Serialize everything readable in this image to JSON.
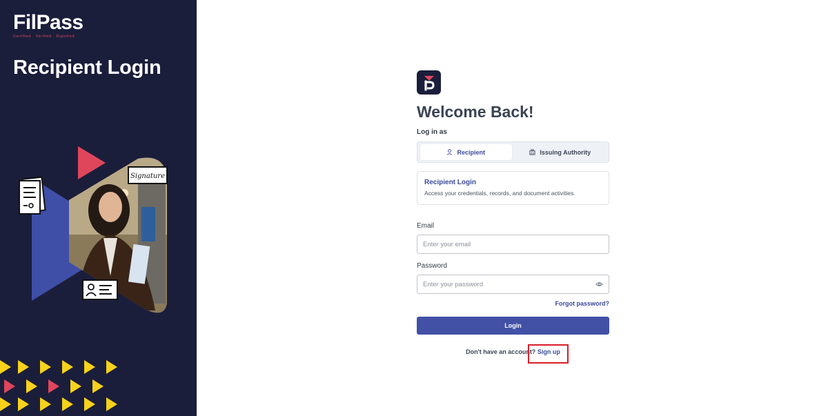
{
  "brand": {
    "name": "FilPass",
    "tagline": "Certified · Verified · Dignified"
  },
  "left_panel": {
    "title": "Recipient Login",
    "signature_card_text": "Signature"
  },
  "main": {
    "welcome": "Welcome Back!",
    "login_as_label": "Log in as",
    "tabs": [
      {
        "label": "Recipient",
        "icon": "user-icon",
        "active": true
      },
      {
        "label": "Issuing Authority",
        "icon": "building-icon",
        "active": false
      }
    ],
    "info_box": {
      "title": "Recipient Login",
      "description": "Access your credentials, records, and document activities."
    },
    "email": {
      "label": "Email",
      "placeholder": "Enter your email",
      "value": ""
    },
    "password": {
      "label": "Password",
      "placeholder": "Enter your password",
      "value": ""
    },
    "forgot_label": "Forgot password?",
    "login_label": "Login",
    "signup_prompt": "Don't have an account?",
    "signup_link": "Sign up"
  },
  "colors": {
    "sidebar_bg": "#1b1e3b",
    "accent": "#4251a6",
    "brand_red": "#e0465b",
    "deco_yellow": "#f7d21c",
    "highlight_red": "#d91d2a"
  }
}
